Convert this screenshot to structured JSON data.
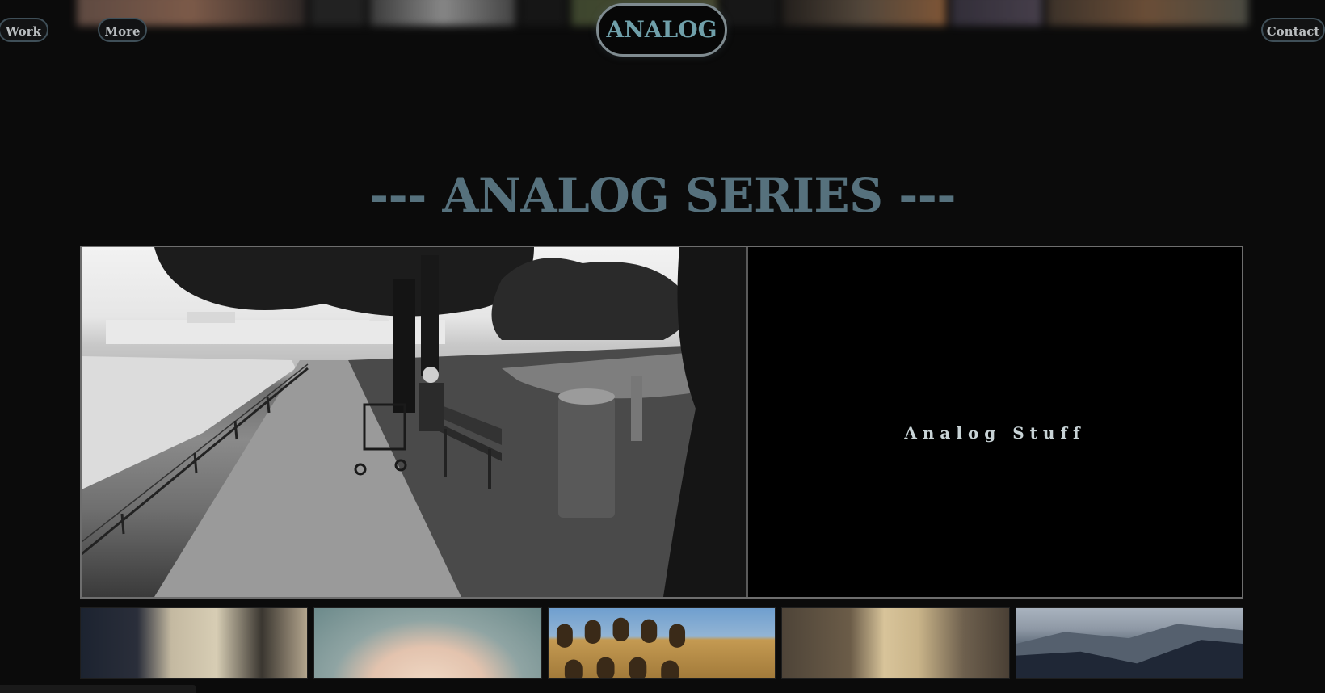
{
  "nav": {
    "work_label": "Work",
    "more_label": "More",
    "contact_label": "Contact",
    "logo_label": "ANALOG"
  },
  "section": {
    "title": "--- ANALOG SERIES ---"
  },
  "feature": {
    "caption": "Analog Stuff",
    "photo_icon": "park-bench-photo"
  },
  "thumbnails": [
    {
      "icon": "weathered-window-photo"
    },
    {
      "icon": "portrait-hands-photo"
    },
    {
      "icon": "colosseum-photo"
    },
    {
      "icon": "figure-in-dress-photo"
    },
    {
      "icon": "mountain-landscape-photo"
    }
  ],
  "colors": {
    "background": "#0b0b0b",
    "accent": "#56717d",
    "logo_text": "#6f9fa9",
    "pill_border": "#3f4f58"
  }
}
